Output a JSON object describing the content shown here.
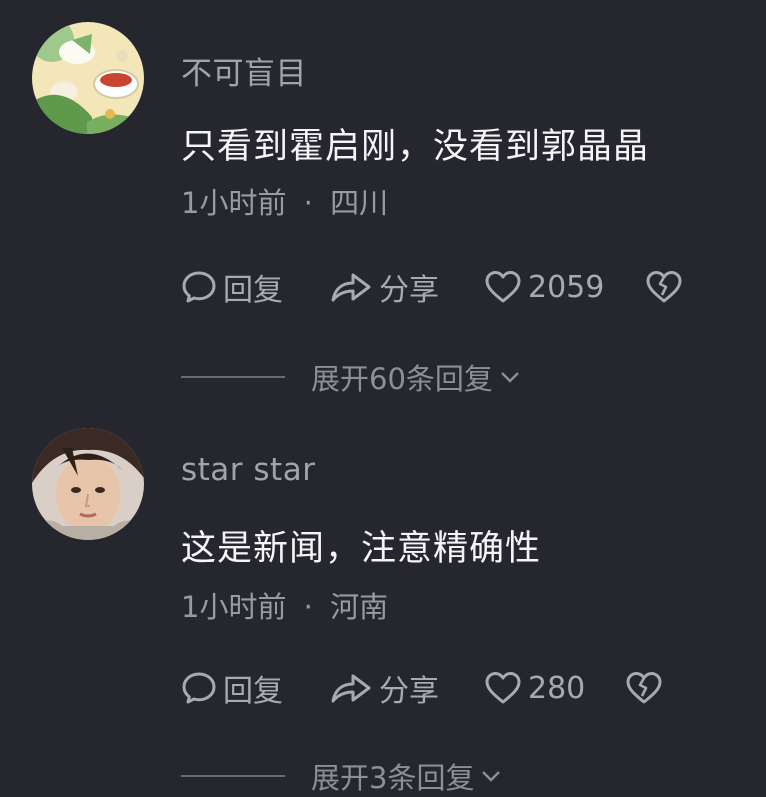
{
  "comments": [
    {
      "username": "不可盲目",
      "text": "只看到霍启刚，没看到郭晶晶",
      "time": "1小时前",
      "separator": "·",
      "location": "四川",
      "reply_label": "回复",
      "share_label": "分享",
      "likes": "2059",
      "expand_label": "展开60条回复",
      "avatar_icon": "food-avatar"
    },
    {
      "username": "star star",
      "text": "这是新闻，注意精确性",
      "time": "1小时前",
      "separator": "·",
      "location": "河南",
      "reply_label": "回复",
      "share_label": "分享",
      "likes": "280",
      "expand_label": "展开3条回复",
      "avatar_icon": "person-avatar"
    }
  ],
  "colors": {
    "background": "#26262e",
    "username": "#a3a3ab",
    "text": "#f5f5f7",
    "meta": "#9a9aa2",
    "action": "#a9a9b1"
  }
}
